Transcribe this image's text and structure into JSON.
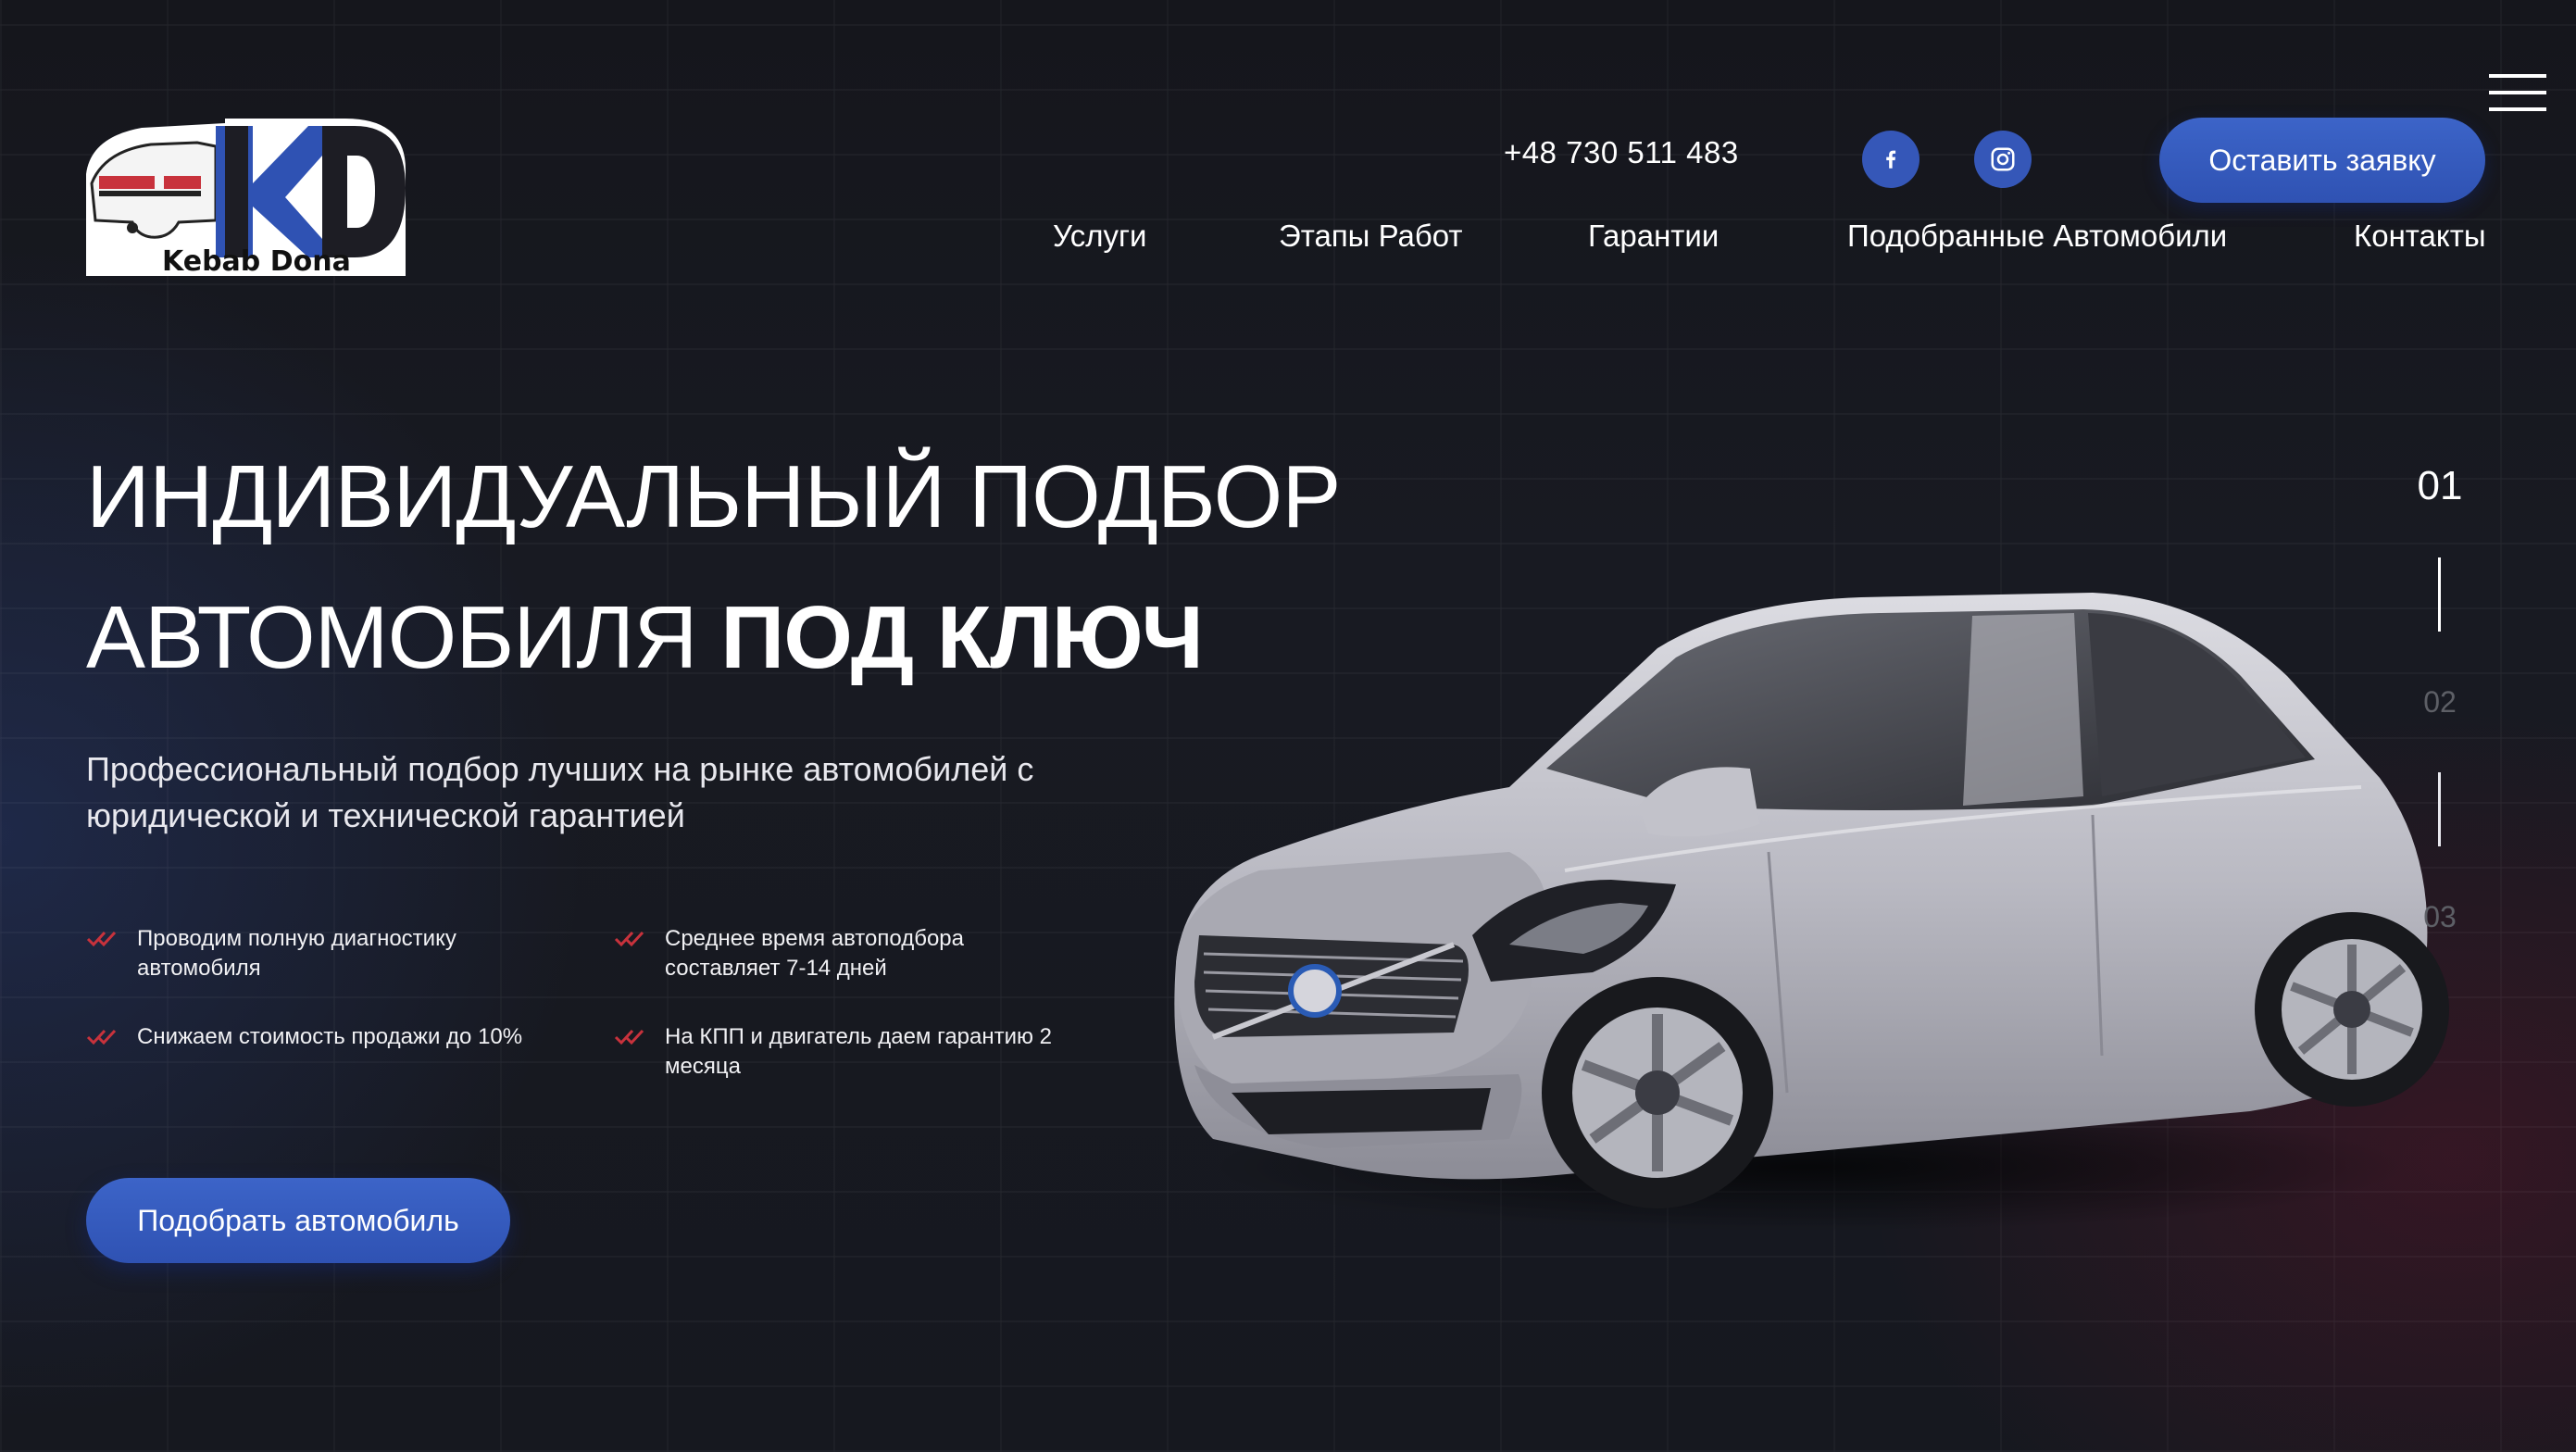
{
  "brand": {
    "logo_letters": "KD",
    "logo_name": "Kebab Dona",
    "accent": "#3557b8",
    "check_color": "#c8323c"
  },
  "header": {
    "phone": "+48 730 511 483",
    "social": [
      {
        "name": "facebook",
        "icon": "facebook-icon"
      },
      {
        "name": "instagram",
        "icon": "instagram-icon"
      }
    ],
    "cta_label": "Оставить заявку",
    "nav": [
      "Услуги",
      "Этапы Работ",
      "Гарантии",
      "Подобранные Автомобили",
      "Контакты"
    ]
  },
  "hero": {
    "title_line1": "ИНДИВИДУАЛЬНЫЙ ПОДБОР",
    "title_line2_light": "АВТОМОБИЛЯ",
    "title_line2_bold": "ПОД КЛЮЧ",
    "subtitle": "Профессиональный подбор лучших на рынке автомобилей с юридической и технической гарантией",
    "features": [
      "Проводим полную диагностику автомобиля",
      "Среднее время автоподбора составляет 7-14 дней",
      "Снижаем стоимость продажи до 10%",
      "На КПП и двигатель даем гарантию 2 месяца"
    ],
    "cta_label": "Подобрать автомобиль"
  },
  "slider": {
    "slides": [
      "01",
      "02",
      "03"
    ],
    "active": "01"
  }
}
